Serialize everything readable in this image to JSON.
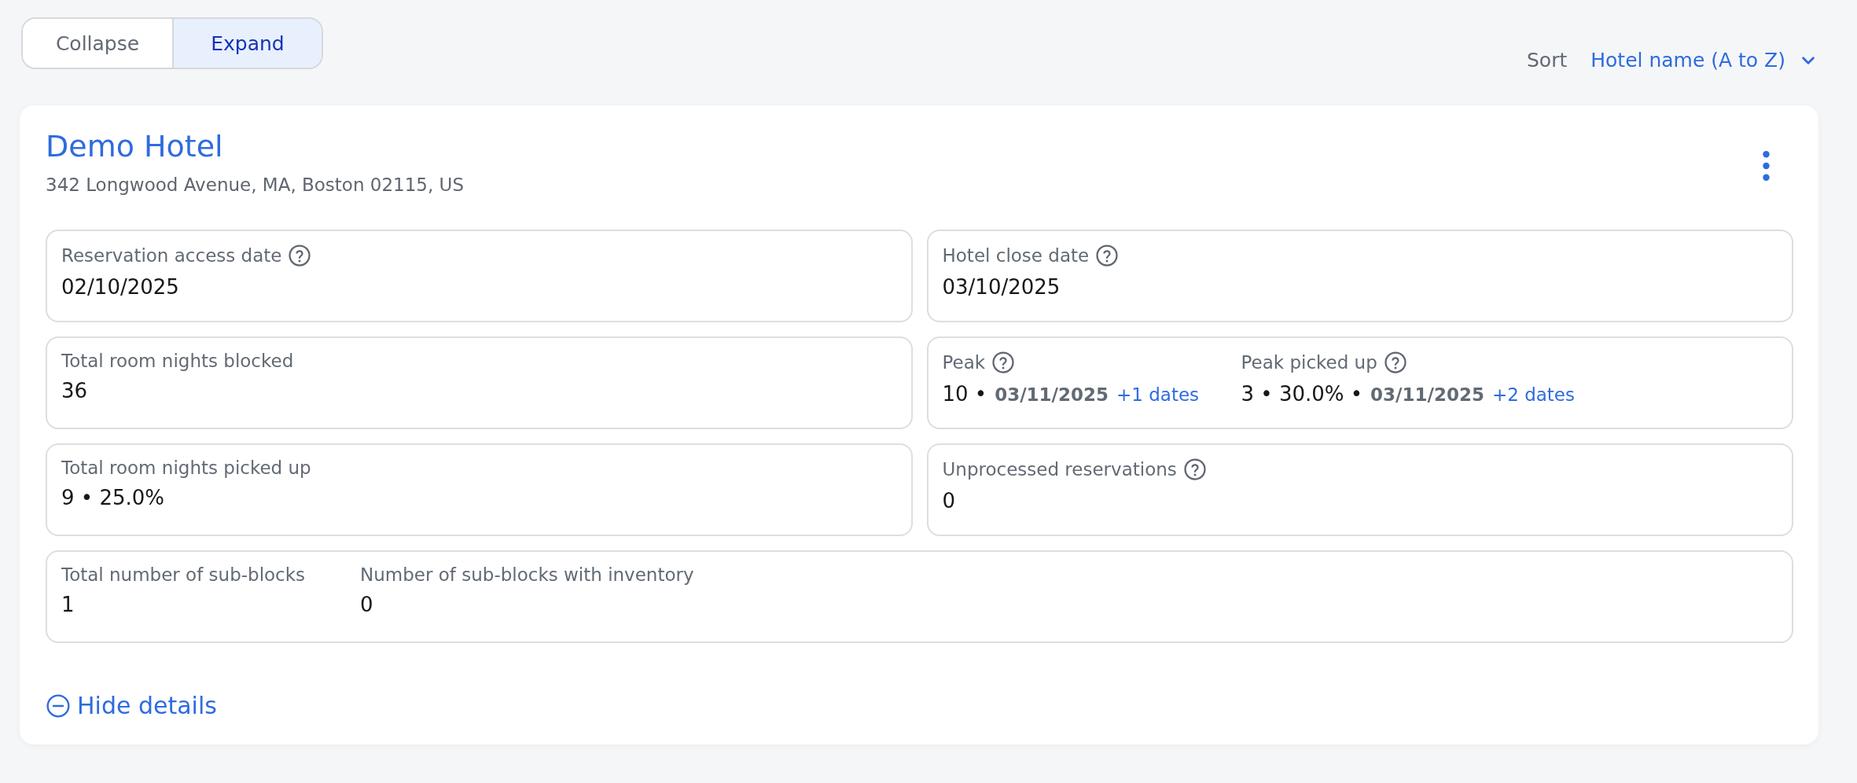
{
  "view_toggle": [
    {
      "label": "Collapse",
      "selected": false
    },
    {
      "label": "Expand",
      "selected": true
    }
  ],
  "sort": {
    "label": "Sort",
    "value": "Hotel name (A to Z)"
  },
  "hotel": {
    "name": "Demo Hotel",
    "address": "342 Longwood Avenue, MA, Boston 02115, US",
    "tiles": [
      {
        "kind": "half",
        "items": [
          {
            "label": "Reservation access date",
            "help": true,
            "value": [
              {
                "kind": "plain",
                "text": "02/10/2025"
              }
            ]
          }
        ]
      },
      {
        "kind": "half",
        "items": [
          {
            "label": "Hotel close date",
            "help": true,
            "value": [
              {
                "kind": "plain",
                "text": "03/10/2025"
              }
            ]
          }
        ]
      },
      {
        "kind": "half",
        "items": [
          {
            "label": "Total room nights blocked",
            "help": false,
            "value": [
              {
                "kind": "plain",
                "text": "36"
              }
            ]
          }
        ]
      },
      {
        "kind": "half",
        "items": [
          {
            "label": "Peak",
            "help": true,
            "value": [
              {
                "kind": "plain",
                "text": "10 •"
              },
              {
                "kind": "date",
                "text": "03/11/2025"
              },
              {
                "kind": "link",
                "text": "+1 dates"
              }
            ]
          },
          {
            "label": "Peak picked up",
            "help": true,
            "value": [
              {
                "kind": "plain",
                "text": "3 • 30.0% •"
              },
              {
                "kind": "date",
                "text": "03/11/2025"
              },
              {
                "kind": "link",
                "text": "+2 dates"
              }
            ]
          }
        ]
      },
      {
        "kind": "half",
        "items": [
          {
            "label": "Total room nights picked up",
            "help": false,
            "value": [
              {
                "kind": "plain",
                "text": "9 • 25.0%"
              }
            ]
          }
        ]
      },
      {
        "kind": "half",
        "items": [
          {
            "label": "Unprocessed reservations",
            "help": true,
            "value": [
              {
                "kind": "plain",
                "text": "0"
              }
            ]
          }
        ]
      },
      {
        "kind": "full",
        "items": [
          {
            "label": "Total number of sub-blocks",
            "help": false,
            "value": [
              {
                "kind": "plain",
                "text": "1"
              }
            ]
          },
          {
            "label": "Number of sub-blocks with inventory",
            "help": false,
            "value": [
              {
                "kind": "plain",
                "text": "0"
              }
            ]
          }
        ]
      }
    ],
    "details_toggle": {
      "label": "Hide details",
      "expanded": true
    }
  }
}
